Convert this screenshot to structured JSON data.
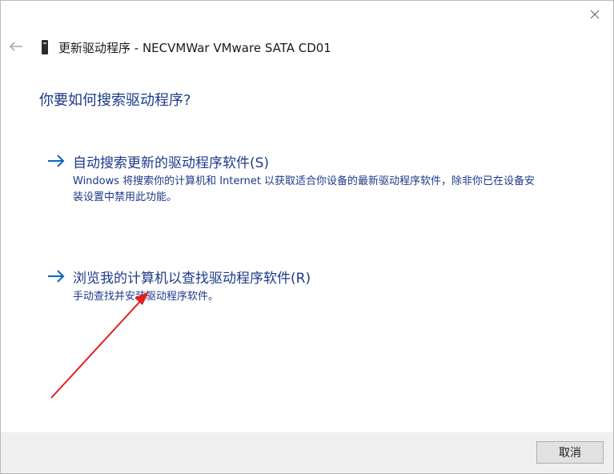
{
  "window": {
    "title": "更新驱动程序 - NECVMWar VMware SATA CD01"
  },
  "content": {
    "heading": "你要如何搜索驱动程序?",
    "options": [
      {
        "title": "自动搜索更新的驱动程序软件(S)",
        "description": "Windows 将搜索你的计算机和 Internet 以获取适合你设备的最新驱动程序软件，除非你已在设备安装设置中禁用此功能。"
      },
      {
        "title": "浏览我的计算机以查找驱动程序软件(R)",
        "description": "手动查找并安装驱动程序软件。"
      }
    ]
  },
  "footer": {
    "cancel_label": "取消"
  },
  "colors": {
    "accent": "#1d3a8a",
    "arrow": "#0a64c8",
    "annotation": "#e02020",
    "footer_bg": "#f0f0f0"
  },
  "icons": {
    "back": "back-arrow-icon",
    "close": "close-icon",
    "device": "cd-drive-icon",
    "option": "right-arrow-icon"
  }
}
